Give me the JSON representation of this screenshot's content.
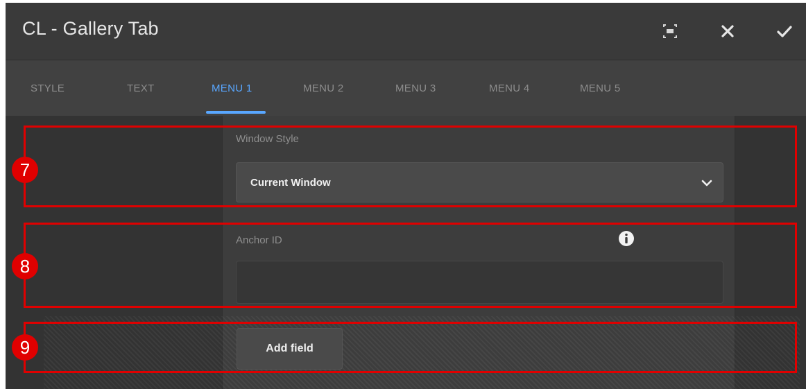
{
  "window": {
    "title": "CL - Gallery Tab",
    "icons": [
      "fullscreen-icon",
      "close-icon",
      "checkmark-icon"
    ]
  },
  "tabs": [
    {
      "label": "STYLE"
    },
    {
      "label": "TEXT"
    },
    {
      "label": "MENU 1",
      "active": true
    },
    {
      "label": "MENU 2"
    },
    {
      "label": "MENU 3"
    },
    {
      "label": "MENU 4"
    },
    {
      "label": "MENU 5"
    }
  ],
  "form": {
    "window_style": {
      "label": "Window Style",
      "value": "Current Window"
    },
    "anchor_id": {
      "label": "Anchor ID",
      "value": ""
    },
    "add_field_label": "Add field"
  },
  "annotations": {
    "markers": [
      "7",
      "8",
      "9"
    ],
    "color": "#e00000"
  },
  "colors": {
    "accent": "#59a7ff",
    "background": "#3c3c3c"
  }
}
